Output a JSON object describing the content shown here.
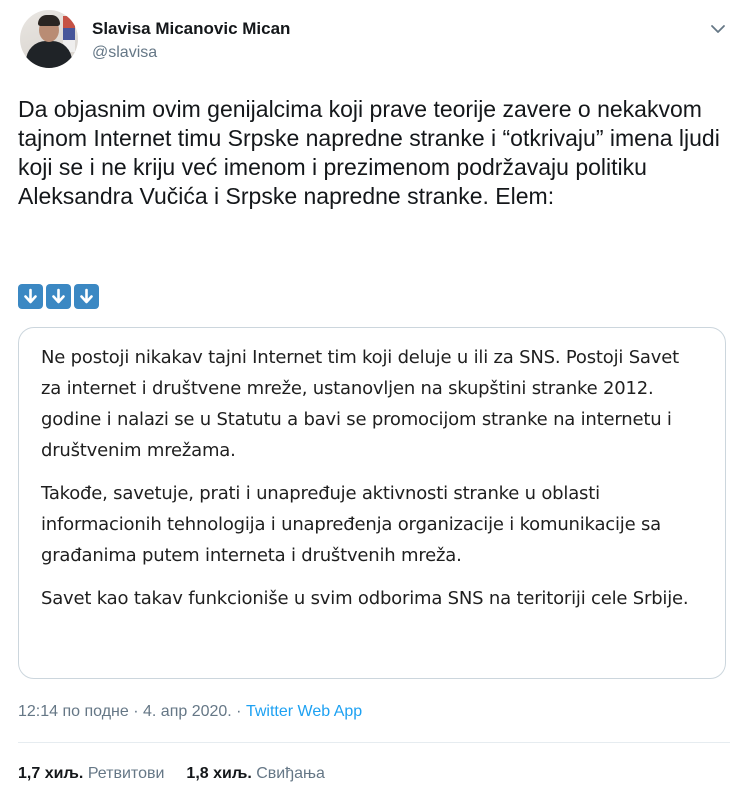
{
  "user": {
    "display_name": "Slavisa Micanovic Mican",
    "handle": "@slavisa"
  },
  "tweet": {
    "text": "Da objasnim ovim genijalcima koji prave teorije zavere o nekakvom tajnom Internet timu Srpske napredne stranke i “otkrivaju” imena ljudi koji se i ne kriju već imenom i prezimenom podržavaju politiku Aleksandra Vučića i Srpske napredne stranke. Elem:",
    "emojis": [
      "arrow-down-icon",
      "arrow-down-icon",
      "arrow-down-icon"
    ]
  },
  "card": {
    "paragraph_1": "Ne postoji nikakav tajni Internet tim koji deluje u ili za SNS. Postoji Savet za internet i društvene mreže, ustanovljen na skupštini stranke 2012. godine i nalazi se u Statutu a bavi se promocijom stranke na internetu i društvenim mrežama.",
    "paragraph_2": "Takođe, savetuje, prati i unapređuje aktivnosti stranke u oblasti informacionih tehnologija i unapređenja organizacije i komunikacije sa građanima putem interneta i društvenih mreža.",
    "paragraph_3": "Savet kao takav funkcioniše u svim odborima SNS na teritoriji cele Srbije."
  },
  "meta": {
    "time": "12:14 по подне",
    "separator": " · ",
    "date": "4. апр 2020.",
    "source": "Twitter Web App"
  },
  "stats": {
    "retweets_count": "1,7 хиљ.",
    "retweets_label": "Ретвитови",
    "likes_count": "1,8 хиљ.",
    "likes_label": "Свиђања"
  },
  "colors": {
    "text": "#14171a",
    "muted": "#657786",
    "link": "#1da1f2",
    "emoji_bg": "#3b88c3",
    "card_border": "#ccd6dd"
  }
}
